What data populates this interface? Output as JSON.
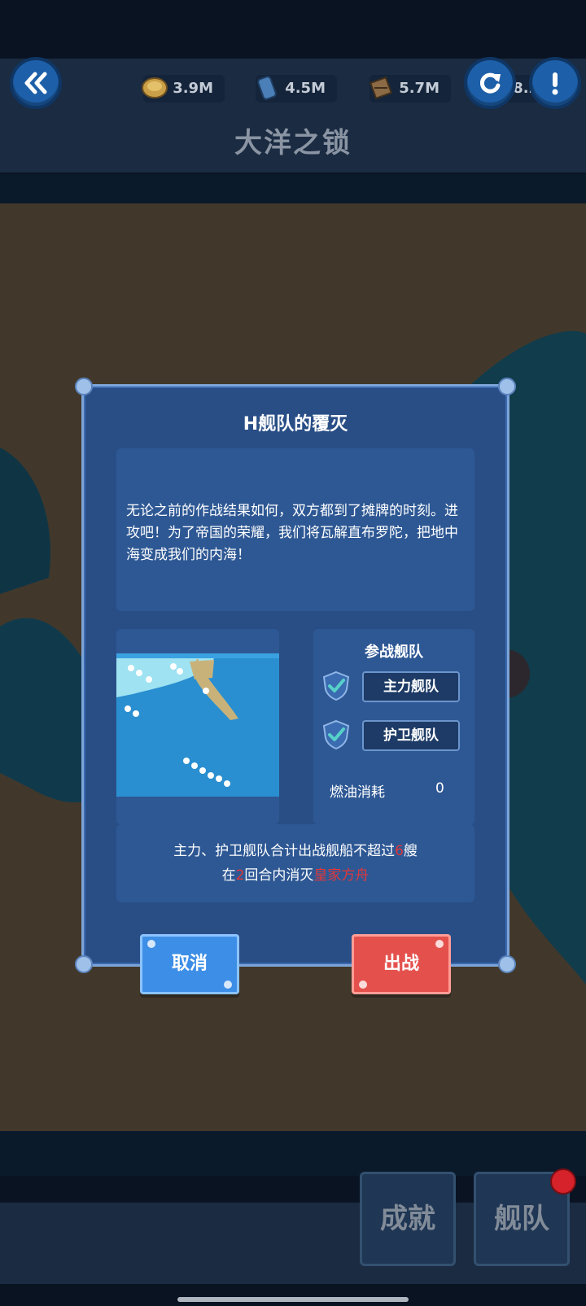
{
  "resources": [
    {
      "icon": "coin-icon",
      "value": "3.9M"
    },
    {
      "icon": "fuel-barrel-icon",
      "value": "4.5M"
    },
    {
      "icon": "ammo-crate-icon",
      "value": "5.7M"
    },
    {
      "icon": "aircraft-icon",
      "value": "38.2M"
    }
  ],
  "header": {
    "title": "大洋之锁"
  },
  "dialog": {
    "title": "H舰队的覆灭",
    "story": "无论之前的作战结果如何，双方都到了摊牌的时刻。进攻吧！为了帝国的荣耀，我们将瓦解直布罗陀，把地中海变成我们的内海！",
    "fleet_heading": "参战舰队",
    "fleets": [
      "主力舰队",
      "护卫舰队"
    ],
    "fuel_label": "燃油消耗",
    "fuel_value": "0",
    "condition": {
      "line1_prefix": "主力、护卫舰队合计出战舰船不超过",
      "line1_num": "6",
      "line1_suffix": "艘",
      "line2_prefix": "在",
      "line2_num": "2",
      "line2_mid": "回合内消灭",
      "line2_target": "皇家方舟"
    },
    "cancel_label": "取消",
    "sortie_label": "出战"
  },
  "bottom": {
    "achievements": "成就",
    "fleet": "舰队"
  },
  "colors": {
    "accent_blue": "#3d8ee6",
    "accent_red": "#e4514c",
    "highlight_red": "#e0373a"
  }
}
